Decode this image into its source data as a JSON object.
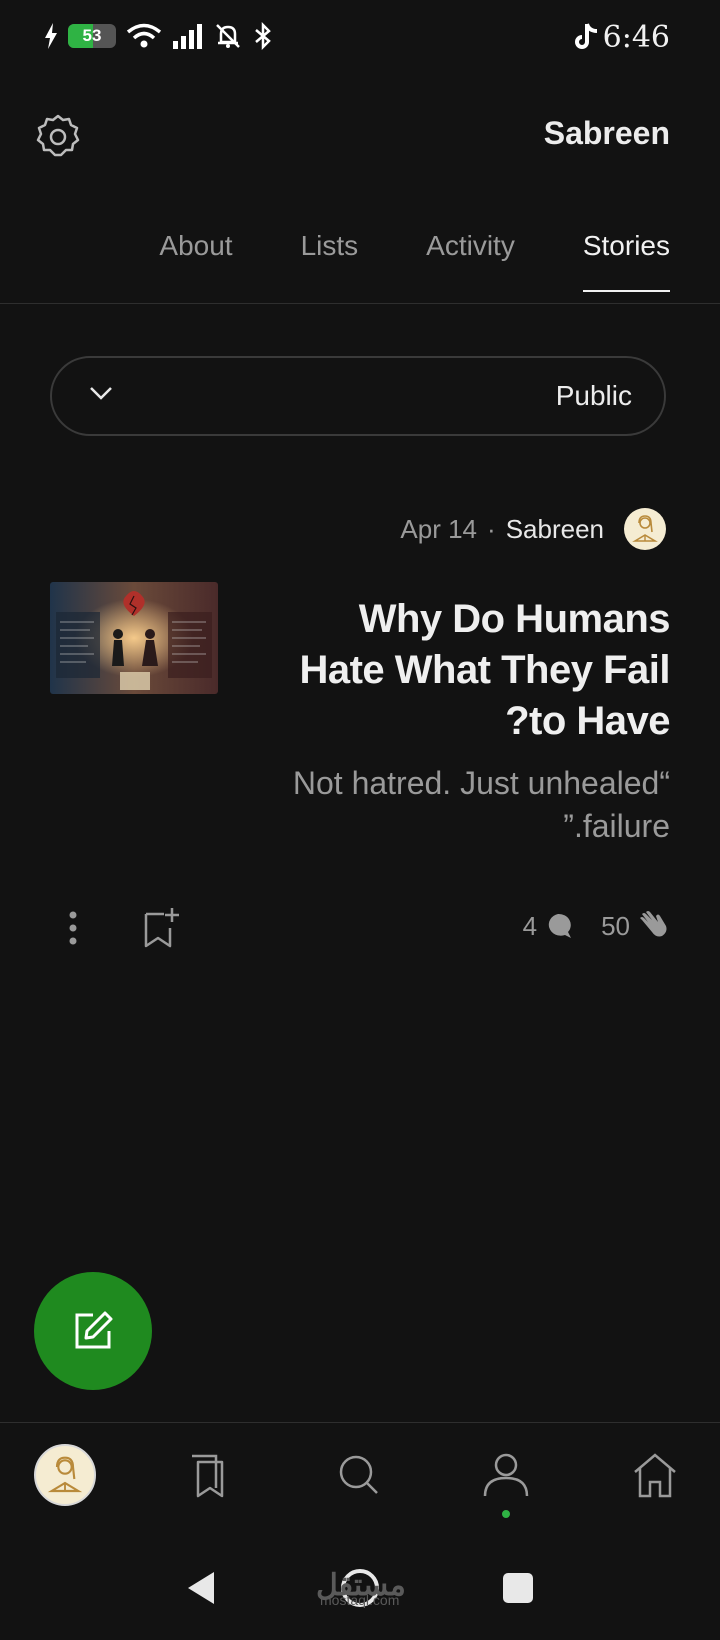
{
  "status_bar": {
    "battery_percent": "53",
    "time": "6:46"
  },
  "header": {
    "profile_name": "Sabreen"
  },
  "tabs": [
    {
      "label": "About"
    },
    {
      "label": "Lists"
    },
    {
      "label": "Activity"
    },
    {
      "label": "Stories",
      "active": true
    }
  ],
  "filter": {
    "selected": "Public"
  },
  "story": {
    "date": "Apr 14",
    "separator": "·",
    "author": "Sabreen",
    "title": "Why Do Humans Hate What They Fail ?to Have",
    "subtitle": "Not hatred. Just unhealed“ ”.failure",
    "comments": "4",
    "claps": "50"
  },
  "watermark": {
    "text": "مستقل",
    "sub": "mostaql.com"
  },
  "colors": {
    "background": "#121212",
    "accent_green": "#1f8a1f",
    "battery_green": "#2fb344",
    "muted_text": "#9a9a9a"
  }
}
